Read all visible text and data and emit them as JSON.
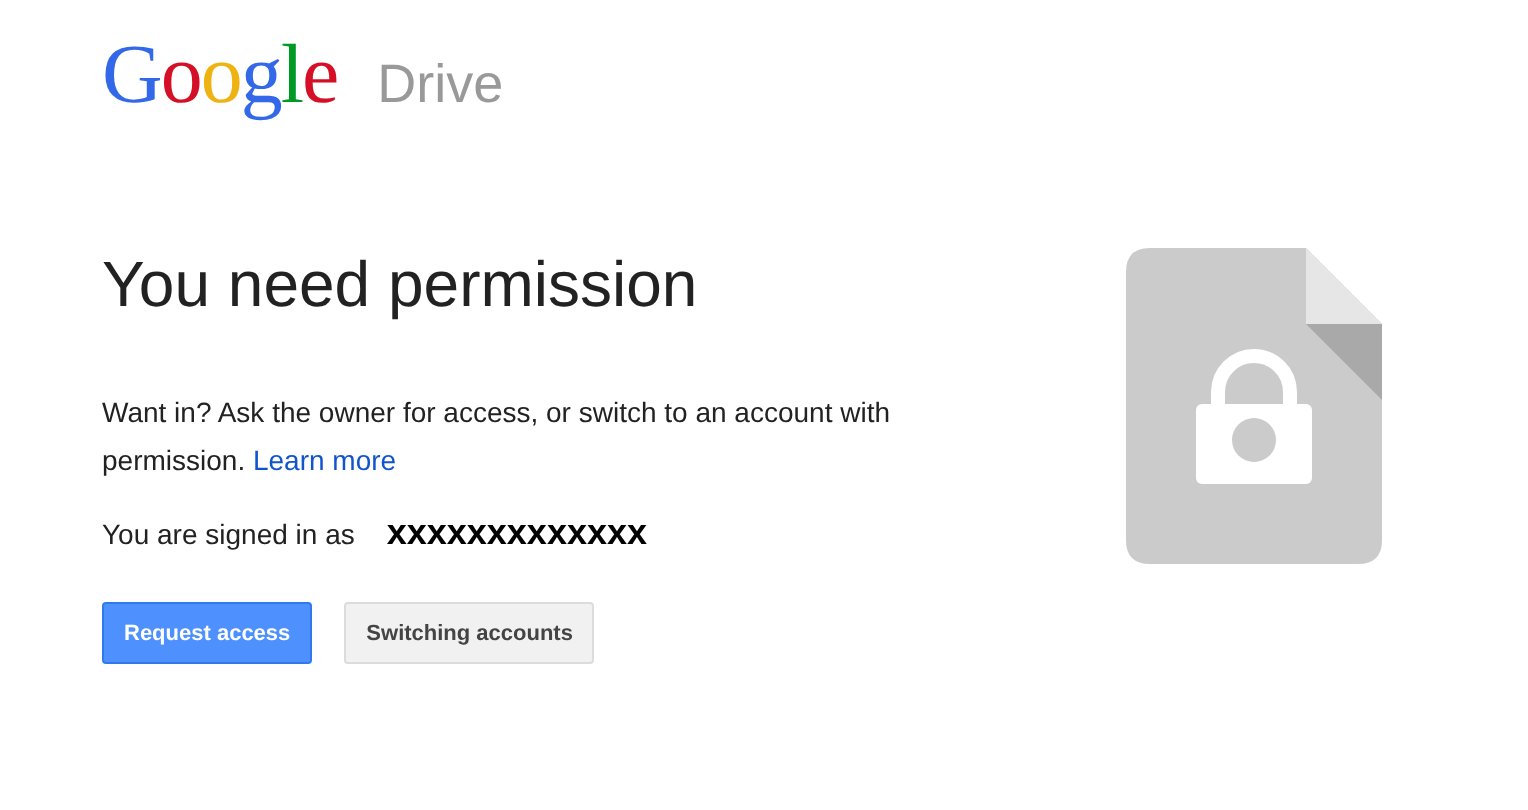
{
  "header": {
    "logo": "Google",
    "product": "Drive"
  },
  "main": {
    "heading": "You need permission",
    "message": "Want in? Ask the owner for access, or switch to an account with permission.",
    "link": "Learn more",
    "signed_in_label": "You are signed in as",
    "account": "xxxxxxxxxxxxx",
    "buttons": [
      {
        "label": "Request access",
        "kind": "primary"
      },
      {
        "label": "Switching accounts",
        "kind": "secondary"
      }
    ]
  }
}
